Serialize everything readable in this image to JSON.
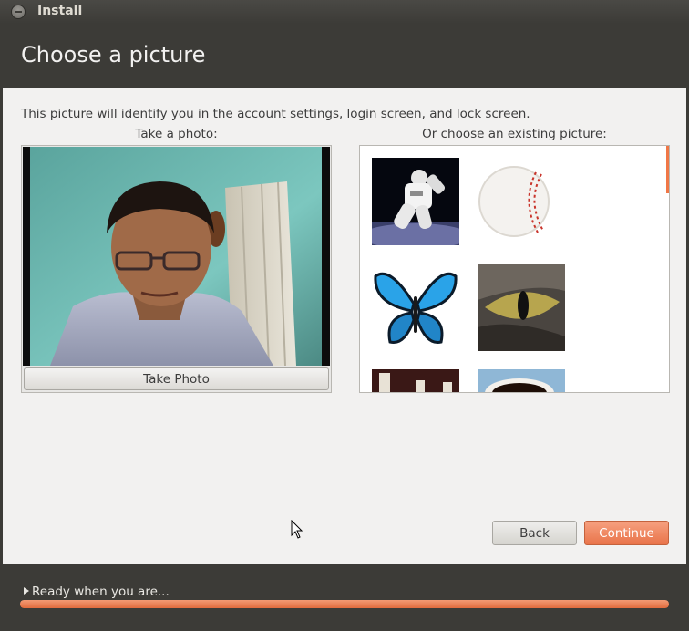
{
  "window": {
    "title": "Install"
  },
  "header": {
    "title": "Choose a picture"
  },
  "main": {
    "intro": "This picture will identify you in the account settings, login screen, and lock screen.",
    "take_photo_label": "Take a photo:",
    "existing_label": "Or choose an existing picture:",
    "take_photo_button": "Take Photo",
    "thumbnails": [
      {
        "name": "astronaut-picture"
      },
      {
        "name": "baseball-picture"
      },
      {
        "name": "butterfly-picture"
      },
      {
        "name": "cat-eye-picture"
      },
      {
        "name": "chess-picture"
      },
      {
        "name": "coffee-picture"
      }
    ]
  },
  "buttons": {
    "back": "Back",
    "continue": "Continue"
  },
  "footer": {
    "status": "Ready when you are...",
    "progress_percent": 100
  },
  "colors": {
    "accent": "#f07746",
    "header_bg": "#3c3b37",
    "content_bg": "#f2f1f0"
  }
}
